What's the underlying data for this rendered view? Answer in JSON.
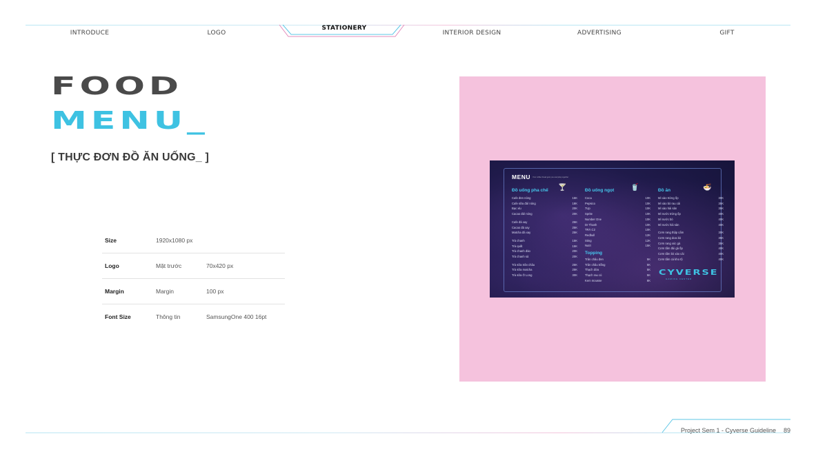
{
  "nav": {
    "items": [
      "INTRODUCE",
      "LOGO",
      "STATIONERY",
      "INTERIOR DESIGN",
      "ADVERTISING",
      "GIFT"
    ],
    "active": "STATIONERY"
  },
  "title": {
    "line1": "FOOD",
    "line2": "MENU_",
    "subtitle": "[ THỰC ĐƠN ĐỒ ĂN UỐNG_ ]"
  },
  "specs": [
    {
      "label": "Size",
      "c2": "1920x1080 px",
      "c3": ""
    },
    {
      "label": "Logo",
      "c2": "Mặt trước",
      "c3": "70x420 px"
    },
    {
      "label": "Margin",
      "c2": "Margin",
      "c3": "100 px"
    },
    {
      "label": "Font Size",
      "c2": "Thông tin",
      "c3": "SamsungOne 400 16pt"
    }
  ],
  "menu_board": {
    "title": "MENU",
    "note": "Your coffee break gets you everyday together",
    "columns": [
      {
        "heading": "Đồ uống pha chế",
        "groups": [
          [
            [
              "Cafe đen nóng",
              "15K"
            ],
            [
              "Cafe sữa đá/ nóng",
              "18K"
            ],
            [
              "Bạc xỉu",
              "20K"
            ],
            [
              "Cacao đá/ nóng",
              "20K"
            ]
          ],
          [
            [
              "Cafe đá xay",
              "25K"
            ],
            [
              "Cacao đá xay",
              "25K"
            ],
            [
              "Matcha đá xay",
              "25K"
            ]
          ],
          [
            [
              "Trà chanh",
              "15K"
            ],
            [
              "Trà quất",
              "15K"
            ],
            [
              "Trà chanh đào",
              "20K"
            ],
            [
              "Trà chanh sả",
              "20K"
            ]
          ],
          [
            [
              "Trà sữa trân châu",
              "25K"
            ],
            [
              "Trà sữa matcha",
              "25K"
            ],
            [
              "Trà sữa Ô Long",
              "30K"
            ]
          ]
        ]
      },
      {
        "heading": "Đồ uống ngọt",
        "groups": [
          [
            [
              "Coca",
              "10K"
            ],
            [
              "Pepsico",
              "10K"
            ],
            [
              "7Up",
              "10K"
            ],
            [
              "Sprite",
              "10K"
            ],
            [
              "Number One",
              "10K"
            ],
            [
              "Dr Thanh",
              "10K"
            ],
            [
              "TRÀ C2",
              "10K"
            ],
            [
              "Redbull",
              "12K"
            ],
            [
              "Sting",
              "12K"
            ],
            [
              "Nutri",
              "15K"
            ]
          ]
        ],
        "subheading": "Topping",
        "topping": [
          [
            "Trân châu đen",
            "5K"
          ],
          [
            "Trân châu trắng",
            "5K"
          ],
          [
            "Thạch dừa",
            "5K"
          ],
          [
            "Thạch rau củ",
            "5K"
          ],
          [
            "Kem mousse",
            "8K"
          ]
        ]
      },
      {
        "heading": "Đồ ăn",
        "groups": [
          [
            [
              "Mì xào trứng ốp",
              "30K"
            ],
            [
              "Mì xào bò rau cải",
              "35K"
            ],
            [
              "Mì xào hải sản",
              "35K"
            ],
            [
              "Mì nước trứng ốp",
              "40K"
            ],
            [
              "Mì nước bò",
              "40K"
            ],
            [
              "Mì nước hải sản",
              "40K"
            ]
          ],
          [
            [
              "Cơm rang thập cẩm",
              "30K"
            ],
            [
              "Cơm rang dưa bò",
              "35K"
            ],
            [
              "Cơm rang xúc gà",
              "35K"
            ],
            [
              "Cơm tấm đùi gà ốp",
              "40K"
            ],
            [
              "Cơm tấm bò xào cải",
              "40K"
            ],
            [
              "Cơm tấm cá kho tộ",
              "40K"
            ]
          ]
        ]
      }
    ],
    "logo": "CYVERSE",
    "logo_sub": "GAMING CENTER"
  },
  "footer": {
    "text": "Project Sem 1 - Cyverse Guideline",
    "page": "89"
  },
  "colors": {
    "accent_cyan": "#3ec2e2",
    "title_gray": "#4a4a4a",
    "panel_pink": "#f5c2dd",
    "board_dark": "#1f1a4a"
  }
}
